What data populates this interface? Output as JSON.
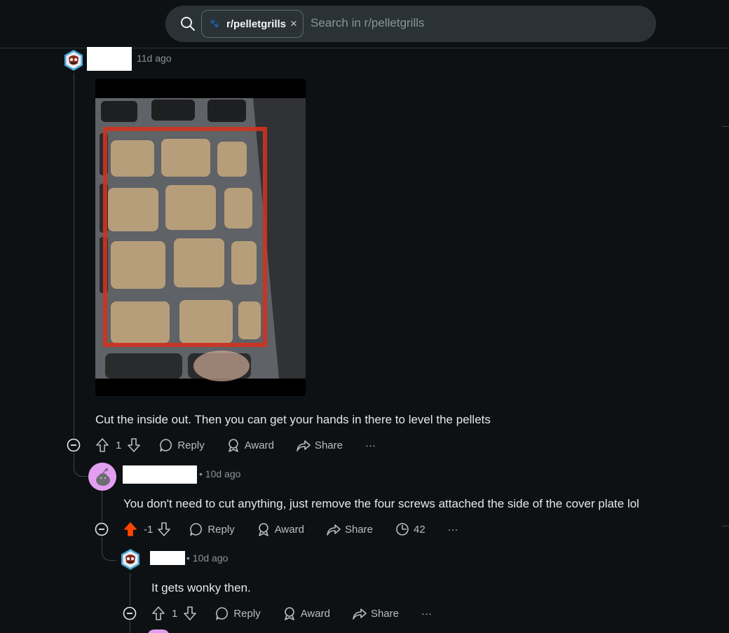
{
  "search": {
    "chip_label": "r/pelletgrills",
    "chip_close": "×",
    "placeholder": "Search in r/pelletgrills"
  },
  "comments": [
    {
      "time": "11d ago",
      "text": "Cut the inside out. Then you can get your hands in there to level the pellets",
      "vote_count": "1",
      "actions": {
        "reply": "Reply",
        "award": "Award",
        "share": "Share",
        "more": "···"
      }
    },
    {
      "time": "• 10d ago",
      "text": "You don't need to cut anything, just remove the four screws attached the side of the cover plate lol",
      "vote_count": "-1",
      "upvoted": true,
      "views": "42",
      "actions": {
        "reply": "Reply",
        "award": "Award",
        "share": "Share",
        "more": "···"
      }
    },
    {
      "time": "• 10d ago",
      "text": "It gets wonky then.",
      "vote_count": "1",
      "actions": {
        "reply": "Reply",
        "award": "Award",
        "share": "Share",
        "more": "···"
      }
    }
  ],
  "colors": {
    "upvote_active": "#ff4500",
    "snoo_avatar": "#e39ef2",
    "link_text": "#d7dadc"
  }
}
